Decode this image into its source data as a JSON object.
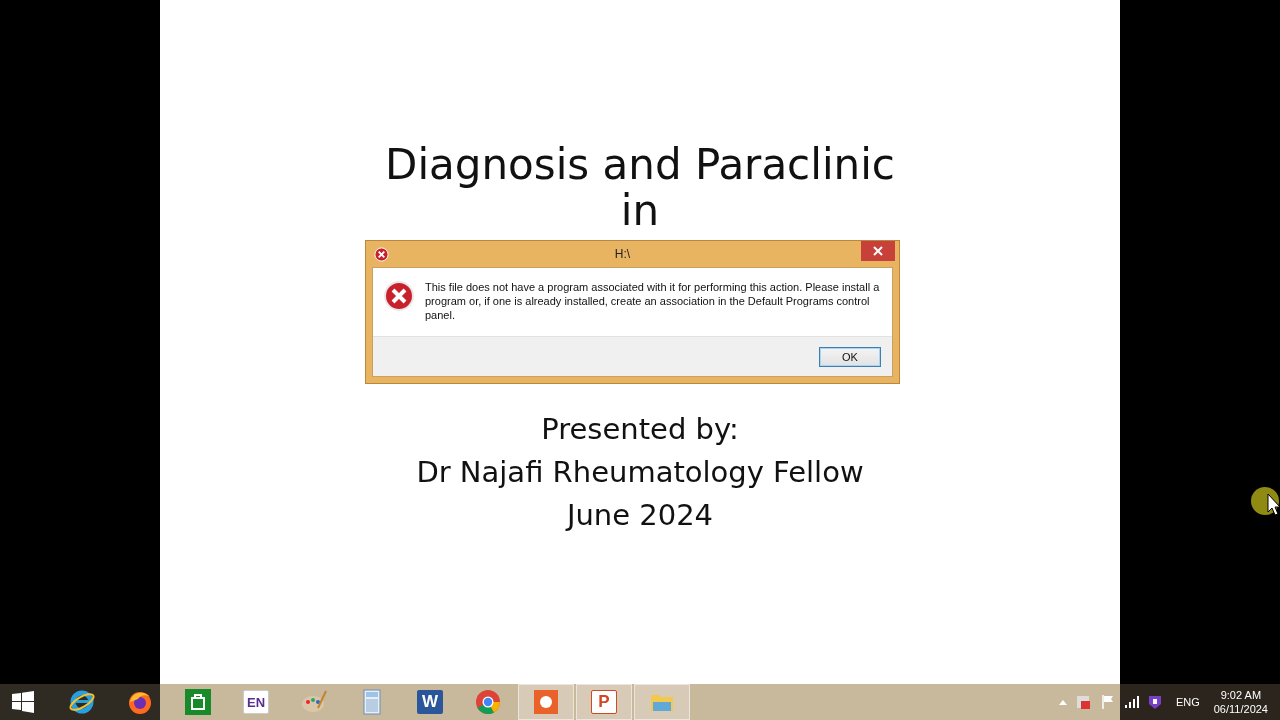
{
  "slide": {
    "title_lines": [
      "Diagnosis and Paraclinic",
      "in"
    ],
    "subtitle_lines": [
      "Presented by:",
      "Dr Najafi Rheumatology Fellow",
      "June 2024"
    ]
  },
  "dialog": {
    "title": "H:\\",
    "message": "This file does not have a program associated with it for performing this action. Please install a program or, if one is already installed, create an association in the Default Programs control panel.",
    "buttons": [
      {
        "label": "OK",
        "selected": true
      }
    ]
  },
  "taskbar": {
    "apps": [
      {
        "kind": "ie",
        "running": false
      },
      {
        "kind": "firefox",
        "running": false
      },
      {
        "kind": "store",
        "running": false
      },
      {
        "kind": "onenote",
        "glyph": "EN",
        "running": false
      },
      {
        "kind": "paint",
        "running": false
      },
      {
        "kind": "calculator",
        "running": false
      },
      {
        "kind": "word",
        "glyph": "W",
        "running": false
      },
      {
        "kind": "chrome",
        "running": false
      },
      {
        "kind": "recorder",
        "running": true
      },
      {
        "kind": "powerpoint",
        "glyph": "P",
        "running": true
      },
      {
        "kind": "explorer",
        "running": true
      }
    ],
    "tray": {
      "language": "ENG",
      "time": "9:02 AM",
      "date": "06/11/2024"
    }
  }
}
